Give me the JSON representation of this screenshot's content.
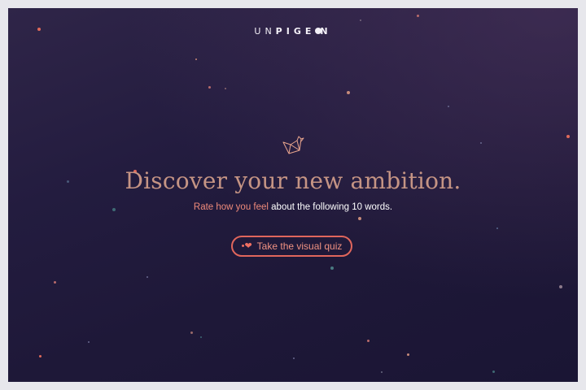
{
  "header": {
    "logo_text": {
      "light": "UN",
      "bold": "PIGE",
      "end": "N"
    }
  },
  "hero": {
    "icon": "origami-bird-icon",
    "headline": "Discover your new ambition.",
    "subline_accent": "Rate how you feel",
    "subline_rest": " about the following 10 words."
  },
  "cta": {
    "icon": "heart-icon",
    "label": "Take the visual quiz"
  },
  "colors": {
    "background": "#231c3f",
    "headline": "#c59484",
    "accent": "#ef8a7a",
    "button_border": "#e0665c"
  }
}
